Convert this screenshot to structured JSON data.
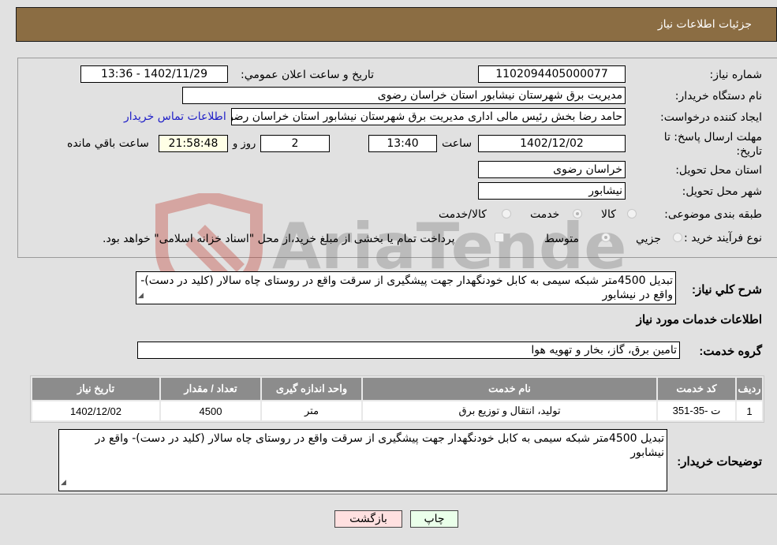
{
  "header": {
    "title": "جزئیات اطلاعات نیاز"
  },
  "form": {
    "need_number": {
      "label": "شماره نیاز:",
      "value": "1102094405000077"
    },
    "announce": {
      "label": "تاریخ و ساعت اعلان عمومي:",
      "value": "1402/11/29 - 13:36"
    },
    "buyer_org": {
      "label": "نام دستگاه خریدار:",
      "value": "مدیریت برق شهرستان نیشابور استان خراسان رضوی"
    },
    "creator": {
      "label": "ایجاد کننده درخواست:",
      "value": "حامد رضا بخش رئیس مالی اداری مدیریت برق شهرستان نیشابور استان خراسان رضوی",
      "contact_link": "اطلاعات تماس خریدار"
    },
    "deadline": {
      "label": "مهلت ارسال پاسخ: تا تاریخ:",
      "date": "1402/12/02",
      "time_label": "ساعت",
      "time": "13:40",
      "days": "2",
      "days_label": "روز و",
      "remaining": "21:58:48",
      "remaining_label": "ساعت باقي مانده"
    },
    "province": {
      "label": "استان محل تحویل:",
      "value": "خراسان رضوی"
    },
    "city": {
      "label": "شهر محل تحویل:",
      "value": "نیشابور"
    },
    "category": {
      "label": "طبقه بندی موضوعی:",
      "options": [
        "کالا",
        "خدمت",
        "کالا/خدمت"
      ],
      "selected": "خدمت"
    },
    "process": {
      "label": "نوع فرآیند خرید :",
      "options": [
        "جزیي",
        "متوسط"
      ],
      "selected": "متوسط",
      "treasury_note": "پرداخت تمام یا بخشی از مبلغ خرید،از محل \"اسناد خزانه اسلامی\" خواهد بود."
    }
  },
  "summary": {
    "label": "شرح کلي نیاز:",
    "value": "تبدیل 4500متر شبکه سیمی به کابل خودنگهدار جهت پیشگیری از سرقت واقع در روستای چاه سالار (کلید در دست)- واقع در  نیشابور"
  },
  "services_title": "اطلاعات خدمات مورد نیاز",
  "service_group": {
    "label": "گروه خدمت:",
    "value": "تامین برق، گاز، بخار و تهویه هوا"
  },
  "table": {
    "headers": [
      "ردیف",
      "کد خدمت",
      "نام خدمت",
      "واحد اندازه گیری",
      "تعداد / مقدار",
      "تاریخ نیاز"
    ],
    "rows": [
      [
        "1",
        "ت -35-351",
        "تولید، انتقال و توزیع برق",
        "متر",
        "4500",
        "1402/12/02"
      ]
    ]
  },
  "buyer_notes": {
    "label": "توضیحات خریدار:",
    "value": "تبدیل 4500متر شبکه سیمی به کابل خودنگهدار جهت پیشگیری از سرقت واقع در روستای چاه سالار (کلید در دست)- واقع در  نیشابور"
  },
  "buttons": {
    "print": "چاپ",
    "back": "بازگشت"
  },
  "watermark": {
    "text": "AriaTender.net",
    "color": "#c0392b"
  }
}
